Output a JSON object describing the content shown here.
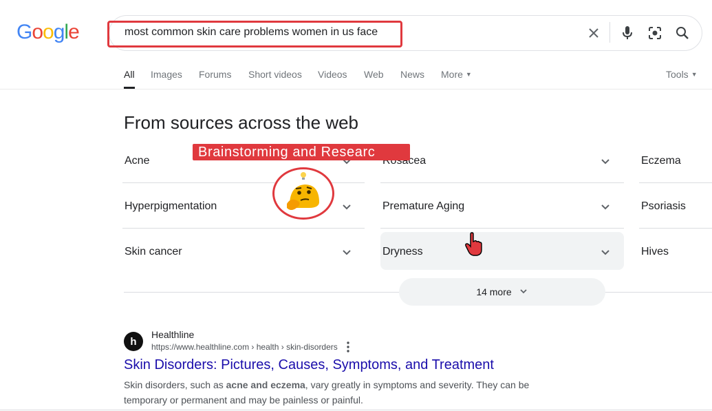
{
  "logo": {
    "letters": [
      "G",
      "o",
      "o",
      "g",
      "l",
      "e"
    ],
    "colors": [
      "#4285f4",
      "#ea4335",
      "#fbbc05",
      "#4285f4",
      "#34a853",
      "#ea4335"
    ]
  },
  "search": {
    "query": "most common skin care problems women in us face"
  },
  "tabs": {
    "all": "All",
    "images": "Images",
    "forums": "Forums",
    "short_videos": "Short videos",
    "videos": "Videos",
    "web": "Web",
    "news": "News",
    "more": "More",
    "tools": "Tools"
  },
  "section": {
    "title": "From sources across the web",
    "topics": [
      "Acne",
      "Rosacea",
      "Eczema",
      "Hyperpigmentation",
      "Premature Aging",
      "Psoriasis",
      "Skin cancer",
      "Dryness",
      "Hives"
    ],
    "more_label": "14 more"
  },
  "overlay": {
    "banner": "Brainstorming and Researc"
  },
  "result": {
    "site_name": "Healthline",
    "site_letter": "h",
    "url": "https://www.healthline.com › health › skin-disorders",
    "title": "Skin Disorders: Pictures, Causes, Symptoms, and Treatment",
    "snippet_pre": "Skin disorders, such as ",
    "snippet_bold": "acne and eczema",
    "snippet_post": ", vary greatly in symptoms and severity. They can be temporary or permanent and may be painless or painful."
  },
  "colors": {
    "accent_red": "#e0393e",
    "link_blue": "#1a0dab"
  },
  "icons": [
    "close-icon",
    "microphone-icon",
    "lens-camera-icon",
    "search-icon",
    "chevron-down-icon",
    "kebab-icon",
    "thinking-face-icon",
    "hand-cursor-icon"
  ]
}
